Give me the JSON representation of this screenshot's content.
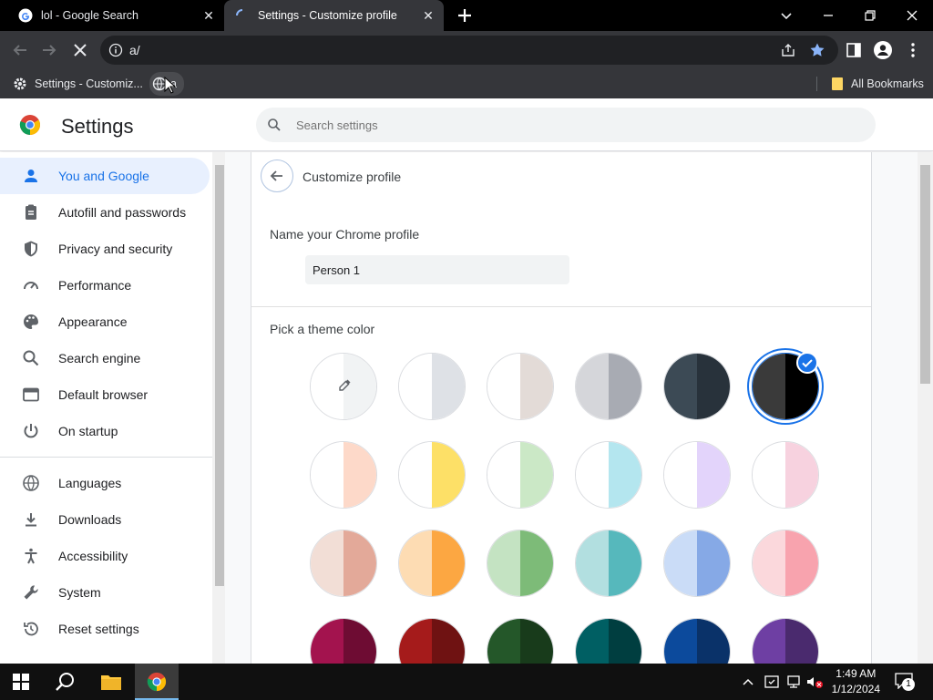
{
  "browser": {
    "tabs": [
      {
        "title": "lol - Google Search",
        "active": false
      },
      {
        "title": "Settings - Customize profile",
        "active": true
      }
    ],
    "address": "a/",
    "bookmarks": [
      {
        "label": "Settings - Customiz..."
      },
      {
        "label": "a"
      }
    ],
    "all_bookmarks_label": "All Bookmarks"
  },
  "settings": {
    "title": "Settings",
    "search_placeholder": "Search settings",
    "nav": [
      {
        "label": "You and Google",
        "icon": "person-icon",
        "active": true
      },
      {
        "label": "Autofill and passwords",
        "icon": "clipboard-icon",
        "active": false
      },
      {
        "label": "Privacy and security",
        "icon": "shield-icon",
        "active": false
      },
      {
        "label": "Performance",
        "icon": "speedometer-icon",
        "active": false
      },
      {
        "label": "Appearance",
        "icon": "palette-icon",
        "active": false
      },
      {
        "label": "Search engine",
        "icon": "search-icon",
        "active": false
      },
      {
        "label": "Default browser",
        "icon": "browser-icon",
        "active": false
      },
      {
        "label": "On startup",
        "icon": "power-icon",
        "active": false
      },
      {
        "label": "Languages",
        "icon": "globe-icon",
        "active": false
      },
      {
        "label": "Downloads",
        "icon": "download-icon",
        "active": false
      },
      {
        "label": "Accessibility",
        "icon": "accessibility-icon",
        "active": false
      },
      {
        "label": "System",
        "icon": "wrench-icon",
        "active": false
      },
      {
        "label": "Reset settings",
        "icon": "history-icon",
        "active": false
      }
    ],
    "page": {
      "title": "Customize profile",
      "name_label": "Name your Chrome profile",
      "name_value": "Person 1",
      "theme_label": "Pick a theme color"
    },
    "theme_colors": [
      {
        "name": "custom",
        "left": "#ffffff",
        "right": "#f1f3f4"
      },
      {
        "name": "default",
        "left": "#ffffff",
        "right": "#dee1e6"
      },
      {
        "name": "warm-grey",
        "left": "#ffffff",
        "right": "#e3dbd7"
      },
      {
        "name": "cool-grey",
        "left": "#d5d6da",
        "right": "#a8abb3"
      },
      {
        "name": "midnight-blue",
        "left": "#3c4a55",
        "right": "#28323b"
      },
      {
        "name": "black",
        "left": "#3a3a3a",
        "right": "#000000"
      },
      {
        "name": "beige-white",
        "left": "#ffffff",
        "right": "#fdd9c9"
      },
      {
        "name": "yellow-white",
        "left": "#ffffff",
        "right": "#fde067"
      },
      {
        "name": "green-white",
        "left": "#ffffff",
        "right": "#cbe8c6"
      },
      {
        "name": "light-teal",
        "left": "#ffffff",
        "right": "#b4e6ef"
      },
      {
        "name": "light-purple",
        "left": "#ffffff",
        "right": "#e3d4fb"
      },
      {
        "name": "pink-white",
        "left": "#ffffff",
        "right": "#f7d2df"
      },
      {
        "name": "beige",
        "left": "#f2ded6",
        "right": "#e3a999"
      },
      {
        "name": "orange",
        "left": "#fddcb3",
        "right": "#fca742"
      },
      {
        "name": "light-green",
        "left": "#c4e3c2",
        "right": "#7dbb78"
      },
      {
        "name": "dark-teal",
        "left": "#b2dfe0",
        "right": "#56b8bc"
      },
      {
        "name": "light-blue",
        "left": "#cadcf7",
        "right": "#86a9e6"
      },
      {
        "name": "pink",
        "left": "#fbd8dc",
        "right": "#f8a3ae"
      },
      {
        "name": "dark-pink",
        "left": "#a3134e",
        "right": "#6e0c33"
      },
      {
        "name": "dark-red",
        "left": "#a51b1b",
        "right": "#6f1212"
      },
      {
        "name": "dark-green",
        "left": "#245729",
        "right": "#183b1b"
      },
      {
        "name": "dark-teal-2",
        "left": "#005f63",
        "right": "#003e40"
      },
      {
        "name": "dark-blue",
        "left": "#0c4a9c",
        "right": "#0a3269"
      },
      {
        "name": "purple",
        "left": "#6e3fa3",
        "right": "#4a2a6e"
      }
    ],
    "selected_theme_index": 5
  },
  "taskbar": {
    "time": "1:49 AM",
    "date": "1/12/2024",
    "notification_count": "1"
  }
}
